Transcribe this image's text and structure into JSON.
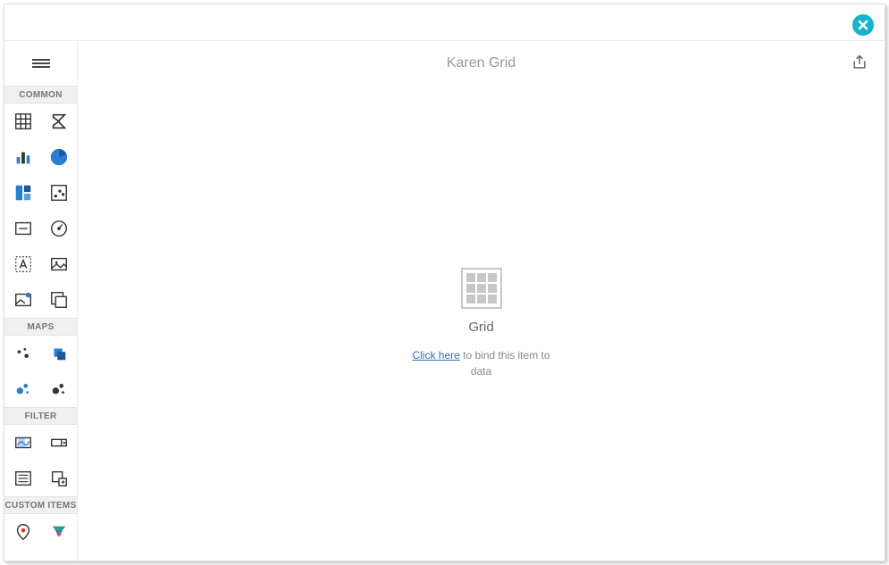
{
  "header": {
    "title": "Karen Grid"
  },
  "close_button": {
    "label": "Close"
  },
  "export_button": {
    "label": "Export"
  },
  "hamburger": {
    "label": "Menu"
  },
  "toolbox": {
    "sections": {
      "common": {
        "label": "COMMON"
      },
      "maps": {
        "label": "MAPS"
      },
      "filter": {
        "label": "FILTER"
      },
      "custom": {
        "label": "CUSTOM ITEMS"
      }
    }
  },
  "placeholder": {
    "label": "Grid",
    "link_text": "Click here",
    "hint_rest": " to bind this item to data"
  }
}
